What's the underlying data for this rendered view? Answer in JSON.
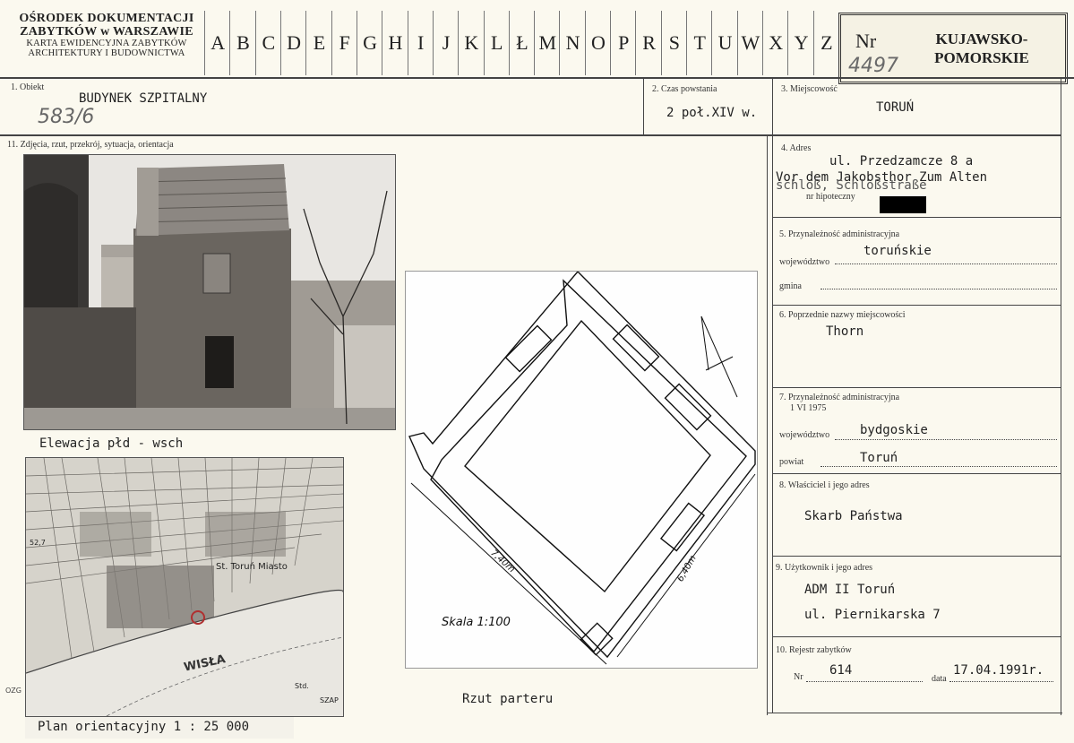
{
  "header": {
    "org_line1": "OŚRODEK DOKUMENTACJI",
    "org_line2": "ZABYTKÓW w WARSZAWIE",
    "org_line3": "KARTA EWIDENCYJNA ZABYTKÓW",
    "org_line4": "ARCHITEKTURY I BUDOWNICTWA",
    "alphabet": [
      "A",
      "B",
      "C",
      "D",
      "E",
      "F",
      "G",
      "H",
      "I",
      "J",
      "K",
      "L",
      "Ł",
      "M",
      "N",
      "O",
      "P",
      "R",
      "S",
      "T",
      "U",
      "W",
      "X",
      "Y",
      "Z"
    ],
    "nr_label": "Nr",
    "nr_value": "4497",
    "region": "KUJAWSKO-\nPOMORSKIE",
    "region_line1": "KUJAWSKO-",
    "region_line2": "POMORSKIE"
  },
  "fields": {
    "obiekt_label": "1. Obiekt",
    "obiekt_value": "BUDYNEK SZPITALNY",
    "obiekt_handnote": "583/6",
    "czas_label": "2. Czas powstania",
    "czas_value": "2 poł.XIV w.",
    "miejscowosc_label": "3. Miejscowość",
    "miejscowosc_value": "TORUŃ",
    "adres_label": "4. Adres",
    "adres_line1": "ul. Przedzamcze 8 a",
    "adres_line2": "Vor dem Jakobsthor Zum Alten",
    "adres_line3": "schloß, Schloßstraße",
    "hipoteczny_label": "nr hipoteczny",
    "przynal_label": "5. Przynależność administracyjna",
    "woj_label": "województwo",
    "woj_value": "toruńskie",
    "gmina_label": "gmina",
    "poprzednie_label": "6. Poprzednie nazwy miejscowości",
    "poprzednie_value": "Thorn",
    "przynal2_label": "7. Przynależność administracyjna",
    "przynal2_date": "1 VI 1975",
    "woj2_label": "województwo",
    "woj2_value": "bydgoskie",
    "powiat_label": "powiat",
    "powiat_value": "Toruń",
    "wlasciciel_label": "8. Właściciel i jego adres",
    "wlasciciel_value": "Skarb Państwa",
    "uzytkownik_label": "9. Użytkownik i jego adres",
    "uzytkownik_line1": "ADM II Toruń",
    "uzytkownik_line2": "ul. Piernikarska 7",
    "rejestr_label": "10. Rejestr zabytków",
    "rejestr_nr_label": "Nr",
    "rejestr_nr_value": "614",
    "rejestr_data_label": "data",
    "rejestr_data_value": "17.04.1991r."
  },
  "section11": {
    "label": "11. Zdjęcia, rzut, przekrój, sytuacja, orientacja",
    "photo_caption": "Elewacja płd - wsch",
    "plan_caption": "Rzut parteru",
    "map_caption": "Plan orientacyjny 1 : 25 000",
    "plan_scale": "Skala 1:100",
    "plan_dim1": "7,40m",
    "plan_dim2": "6,40m",
    "map_label_wisla": "WISŁA",
    "map_label_miasto": "St. Toruń Miasto",
    "map_label_527": "52,7",
    "map_label_std": "Std.",
    "map_label_szp": "SZAP",
    "map_label_ozg": "OZG"
  },
  "colors": {
    "paper": "#fbf9ef",
    "ink": "#222222",
    "map_marker": "#b03030"
  }
}
